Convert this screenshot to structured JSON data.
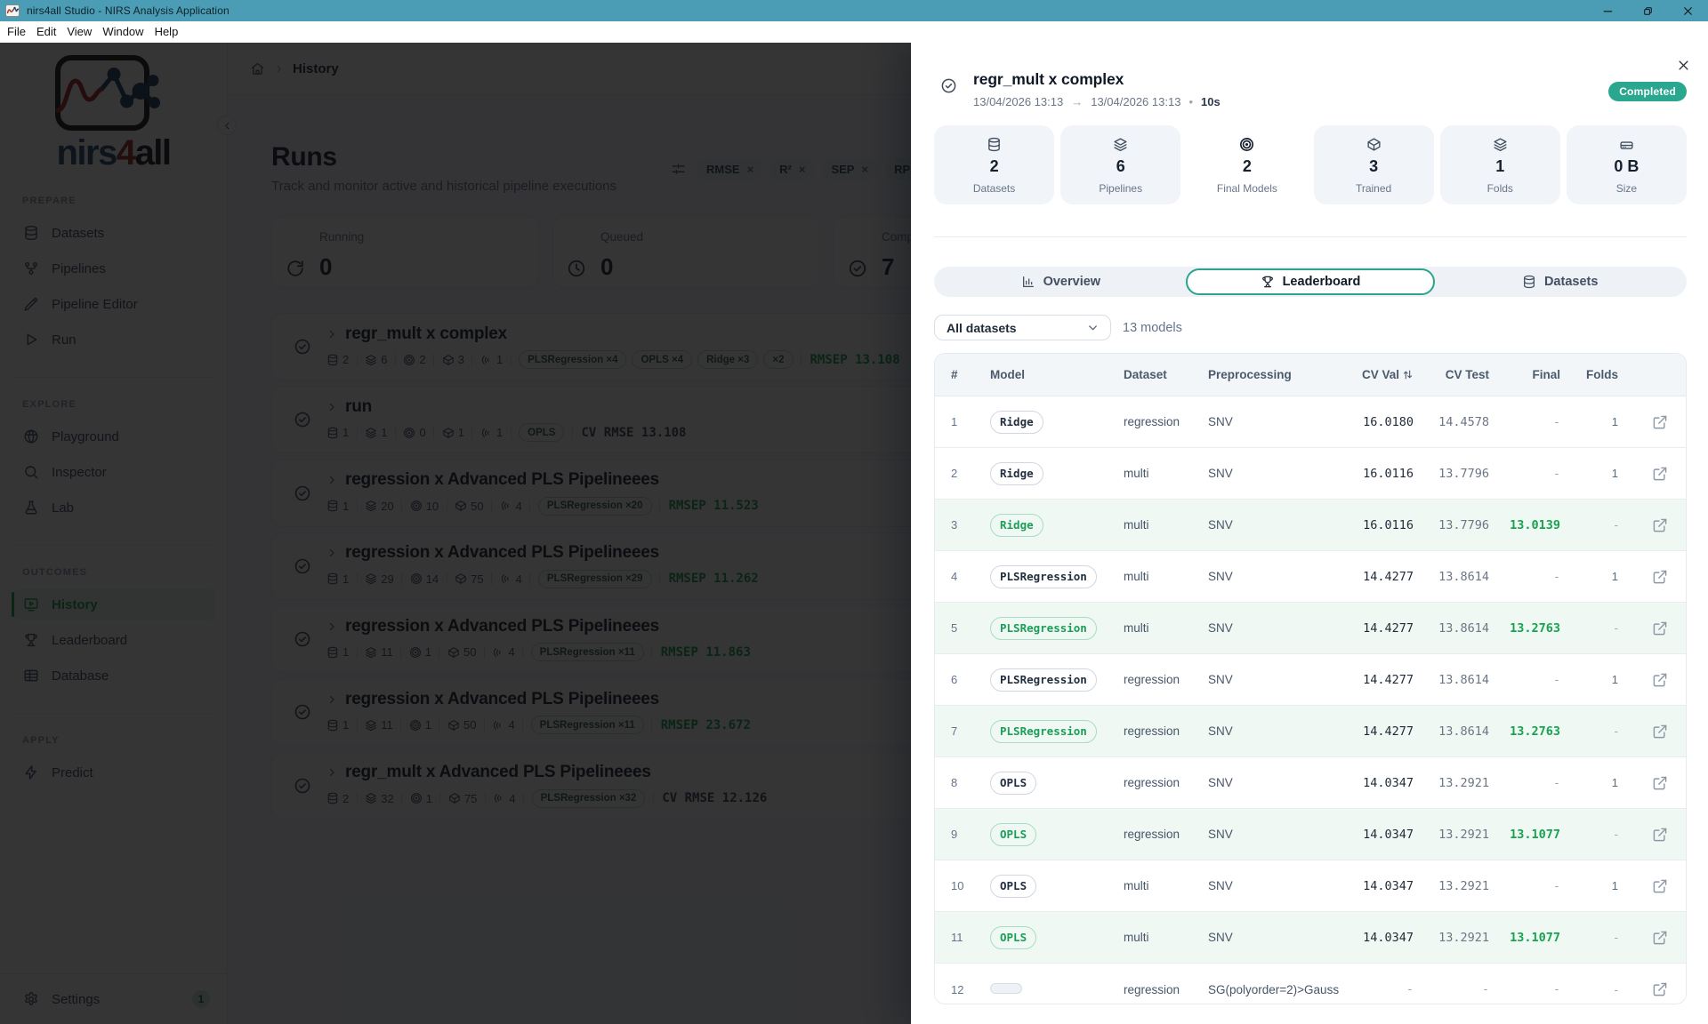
{
  "window": {
    "title": "nirs4all Studio - NIRS Analysis Application"
  },
  "menu": {
    "items": [
      "File",
      "Edit",
      "View",
      "Window",
      "Help"
    ]
  },
  "sidebar": {
    "logo": {
      "part1": "nirs",
      "part2": "4",
      "part3": "all"
    },
    "sections": [
      {
        "label": "PREPARE",
        "items": [
          {
            "label": "Datasets",
            "icon": "database",
            "active": false
          },
          {
            "label": "Pipelines",
            "icon": "workflow",
            "active": false
          },
          {
            "label": "Pipeline Editor",
            "icon": "pencil",
            "active": false
          },
          {
            "label": "Run",
            "icon": "play",
            "active": false
          }
        ]
      },
      {
        "label": "EXPLORE",
        "items": [
          {
            "label": "Playground",
            "icon": "sphere",
            "active": false
          },
          {
            "label": "Inspector",
            "icon": "search",
            "active": false
          },
          {
            "label": "Lab",
            "icon": "flask",
            "active": false
          }
        ]
      },
      {
        "label": "OUTCOMES",
        "items": [
          {
            "label": "History",
            "icon": "history",
            "active": true
          },
          {
            "label": "Leaderboard",
            "icon": "trophy",
            "active": false
          },
          {
            "label": "Database",
            "icon": "table",
            "active": false
          }
        ]
      },
      {
        "label": "APPLY",
        "items": [
          {
            "label": "Predict",
            "icon": "zap",
            "active": false
          }
        ]
      }
    ],
    "settings": {
      "label": "Settings",
      "badge": "1"
    }
  },
  "breadcrumb": {
    "page": "History"
  },
  "runs_page": {
    "title": "Runs",
    "subtitle": "Track and monitor active and historical pipeline executions",
    "filters": [
      "RMSE",
      "R²",
      "SEP",
      "RPD"
    ],
    "summary_cards": [
      {
        "label": "Running",
        "value": "0",
        "icon": "refresh"
      },
      {
        "label": "Queued",
        "value": "0",
        "icon": "clock"
      },
      {
        "label": "Completed",
        "value": "7",
        "icon": "check-circle"
      }
    ],
    "runs": [
      {
        "title": "regr_mult x complex",
        "stats": [
          "2",
          "6",
          "2",
          "3",
          "1"
        ],
        "chips": [
          "PLSRegression ×4",
          "OPLS ×4",
          "Ridge ×3",
          "×2"
        ],
        "metric": "RMSEP 13.108",
        "metric_color": "green"
      },
      {
        "title": "run",
        "stats": [
          "1",
          "1",
          "0",
          "1",
          "1"
        ],
        "chips": [
          "OPLS"
        ],
        "metric": "CV RMSE 13.108",
        "metric_color": "dark"
      },
      {
        "title": "regression x Advanced PLS Pipelineees",
        "stats": [
          "1",
          "20",
          "10",
          "50",
          "4"
        ],
        "chips": [
          "PLSRegression ×20"
        ],
        "metric": "RMSEP 11.523",
        "metric_color": "green"
      },
      {
        "title": "regression x Advanced PLS Pipelineees",
        "stats": [
          "1",
          "29",
          "14",
          "75",
          "4"
        ],
        "chips": [
          "PLSRegression ×29"
        ],
        "metric": "RMSEP 11.262",
        "metric_color": "green"
      },
      {
        "title": "regression x Advanced PLS Pipelineees",
        "stats": [
          "1",
          "11",
          "1",
          "50",
          "4"
        ],
        "chips": [
          "PLSRegression ×11"
        ],
        "metric": "RMSEP 11.863",
        "metric_color": "green"
      },
      {
        "title": "regression x Advanced PLS Pipelineees",
        "stats": [
          "1",
          "11",
          "1",
          "50",
          "4"
        ],
        "chips": [
          "PLSRegression ×11"
        ],
        "metric": "RMSEP 23.672",
        "metric_color": "green"
      },
      {
        "title": "regr_mult x Advanced PLS Pipelineees",
        "stats": [
          "2",
          "32",
          "1",
          "75",
          "4"
        ],
        "chips": [
          "PLSRegression ×32"
        ],
        "metric": "CV RMSE 12.126",
        "metric_color": "dark"
      }
    ]
  },
  "drawer": {
    "title": "regr_mult x complex",
    "started": "13/04/2026 13:13",
    "arrow": "→",
    "ended": "13/04/2026 13:13",
    "dot": "•",
    "duration": "10s",
    "status": "Completed",
    "stats": [
      {
        "value": "2",
        "label": "Datasets",
        "icon": "database",
        "plain": false
      },
      {
        "value": "6",
        "label": "Pipelines",
        "icon": "layers",
        "plain": false
      },
      {
        "value": "2",
        "label": "Final Models",
        "icon": "target",
        "plain": true
      },
      {
        "value": "3",
        "label": "Trained",
        "icon": "package",
        "plain": false
      },
      {
        "value": "1",
        "label": "Folds",
        "icon": "layers",
        "plain": false
      },
      {
        "value": "0 B",
        "label": "Size",
        "icon": "drive",
        "plain": false
      }
    ],
    "tabs": [
      {
        "label": "Overview",
        "icon": "chart",
        "active": false
      },
      {
        "label": "Leaderboard",
        "icon": "trophy",
        "active": true
      },
      {
        "label": "Datasets",
        "icon": "database",
        "active": false
      }
    ],
    "dataset_filter": "All datasets",
    "models_count": "13 models",
    "table": {
      "columns": [
        "#",
        "Model",
        "Dataset",
        "Preprocessing",
        "CV Val",
        "CV Test",
        "Final",
        "Folds",
        ""
      ],
      "sorted_column": "CV Val",
      "rows": [
        {
          "rank": "1",
          "model": "Ridge",
          "model_style": "default",
          "dataset": "regression",
          "preprocessing": "SNV",
          "cv_val": "16.0180",
          "cv_test": "14.4578",
          "final": "-",
          "folds": "1",
          "highlight": false
        },
        {
          "rank": "2",
          "model": "Ridge",
          "model_style": "default",
          "dataset": "multi",
          "preprocessing": "SNV",
          "cv_val": "16.0116",
          "cv_test": "13.7796",
          "final": "-",
          "folds": "1",
          "highlight": false
        },
        {
          "rank": "3",
          "model": "Ridge",
          "model_style": "green",
          "dataset": "multi",
          "preprocessing": "SNV",
          "cv_val": "16.0116",
          "cv_test": "13.7796",
          "final": "13.0139",
          "folds": "-",
          "highlight": true
        },
        {
          "rank": "4",
          "model": "PLSRegression",
          "model_style": "default",
          "dataset": "multi",
          "preprocessing": "SNV",
          "cv_val": "14.4277",
          "cv_test": "13.8614",
          "final": "-",
          "folds": "1",
          "highlight": false
        },
        {
          "rank": "5",
          "model": "PLSRegression",
          "model_style": "green",
          "dataset": "multi",
          "preprocessing": "SNV",
          "cv_val": "14.4277",
          "cv_test": "13.8614",
          "final": "13.2763",
          "folds": "-",
          "highlight": true
        },
        {
          "rank": "6",
          "model": "PLSRegression",
          "model_style": "default",
          "dataset": "regression",
          "preprocessing": "SNV",
          "cv_val": "14.4277",
          "cv_test": "13.8614",
          "final": "-",
          "folds": "1",
          "highlight": false
        },
        {
          "rank": "7",
          "model": "PLSRegression",
          "model_style": "green",
          "dataset": "regression",
          "preprocessing": "SNV",
          "cv_val": "14.4277",
          "cv_test": "13.8614",
          "final": "13.2763",
          "folds": "-",
          "highlight": true
        },
        {
          "rank": "8",
          "model": "OPLS",
          "model_style": "default",
          "dataset": "regression",
          "preprocessing": "SNV",
          "cv_val": "14.0347",
          "cv_test": "13.2921",
          "final": "-",
          "folds": "1",
          "highlight": false
        },
        {
          "rank": "9",
          "model": "OPLS",
          "model_style": "green",
          "dataset": "regression",
          "preprocessing": "SNV",
          "cv_val": "14.0347",
          "cv_test": "13.2921",
          "final": "13.1077",
          "folds": "-",
          "highlight": true
        },
        {
          "rank": "10",
          "model": "OPLS",
          "model_style": "default",
          "dataset": "multi",
          "preprocessing": "SNV",
          "cv_val": "14.0347",
          "cv_test": "13.2921",
          "final": "-",
          "folds": "1",
          "highlight": false
        },
        {
          "rank": "11",
          "model": "OPLS",
          "model_style": "green",
          "dataset": "multi",
          "preprocessing": "SNV",
          "cv_val": "14.0347",
          "cv_test": "13.2921",
          "final": "13.1077",
          "folds": "-",
          "highlight": true
        },
        {
          "rank": "12",
          "model": "",
          "model_style": "empty",
          "dataset": "regression",
          "preprocessing": "SG(polyorder=2)>Gauss",
          "cv_val": "-",
          "cv_test": "-",
          "final": "-",
          "folds": "-",
          "highlight": false
        }
      ]
    }
  },
  "colors": {
    "titlebar": "#4a9db4",
    "accent_teal": "#2aa78f",
    "accent_green": "#17a34a",
    "highlight_row": "#f0f8f3"
  }
}
